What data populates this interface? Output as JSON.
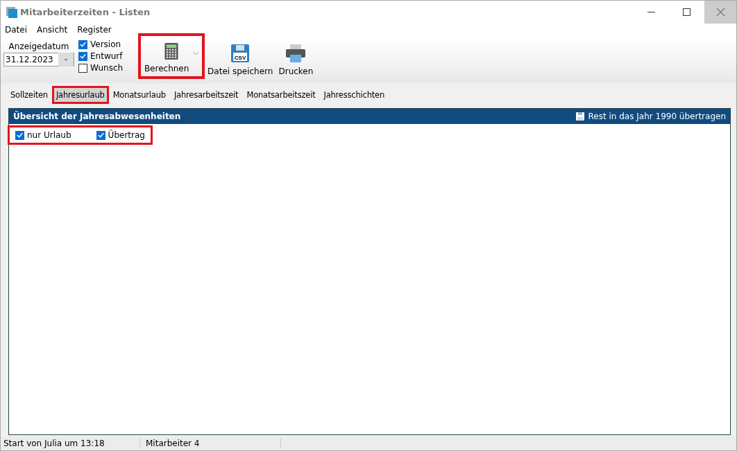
{
  "window": {
    "title": "Mitarbeiterzeiten - Listen"
  },
  "menu": [
    "Datei",
    "Ansicht",
    "Register"
  ],
  "date": {
    "label": "Anzeigedatum",
    "value": "31.12.2023"
  },
  "options": [
    {
      "label": "Version",
      "checked": true
    },
    {
      "label": "Entwurf",
      "checked": true
    },
    {
      "label": "Wunsch",
      "checked": false
    }
  ],
  "tools": [
    {
      "kind": "calculator",
      "label": "Berechnen",
      "dropdown": true,
      "highlighted": true
    },
    {
      "kind": "csv",
      "icon_text": "CSV",
      "label": "Datei speichern",
      "dropdown": false,
      "highlighted": false
    },
    {
      "kind": "printer",
      "label": "Drucken",
      "dropdown": false,
      "highlighted": false
    }
  ],
  "tabs": [
    {
      "label": "Sollzeiten",
      "selected": false,
      "highlighted": false
    },
    {
      "label": "Jahresurlaub",
      "selected": true,
      "highlighted": true
    },
    {
      "label": "Monatsurlaub",
      "selected": false,
      "highlighted": false
    },
    {
      "label": "Jahresarbeitszeit",
      "selected": false,
      "highlighted": false
    },
    {
      "label": "Monatsarbeitszeit",
      "selected": false,
      "highlighted": false
    },
    {
      "label": "Jahresschichten",
      "selected": false,
      "highlighted": false
    }
  ],
  "panel": {
    "title": "Übersicht der Jahresabwesenheiten",
    "action": "Rest in das Jahr 1990 übertragen",
    "filters_highlighted": true,
    "filters": [
      {
        "label": "nur Urlaub",
        "checked": true
      },
      {
        "label": "Übertrag",
        "checked": true
      }
    ]
  },
  "status_bar": [
    "Start von Julia um 13:18",
    "Mitarbeiter 4"
  ]
}
